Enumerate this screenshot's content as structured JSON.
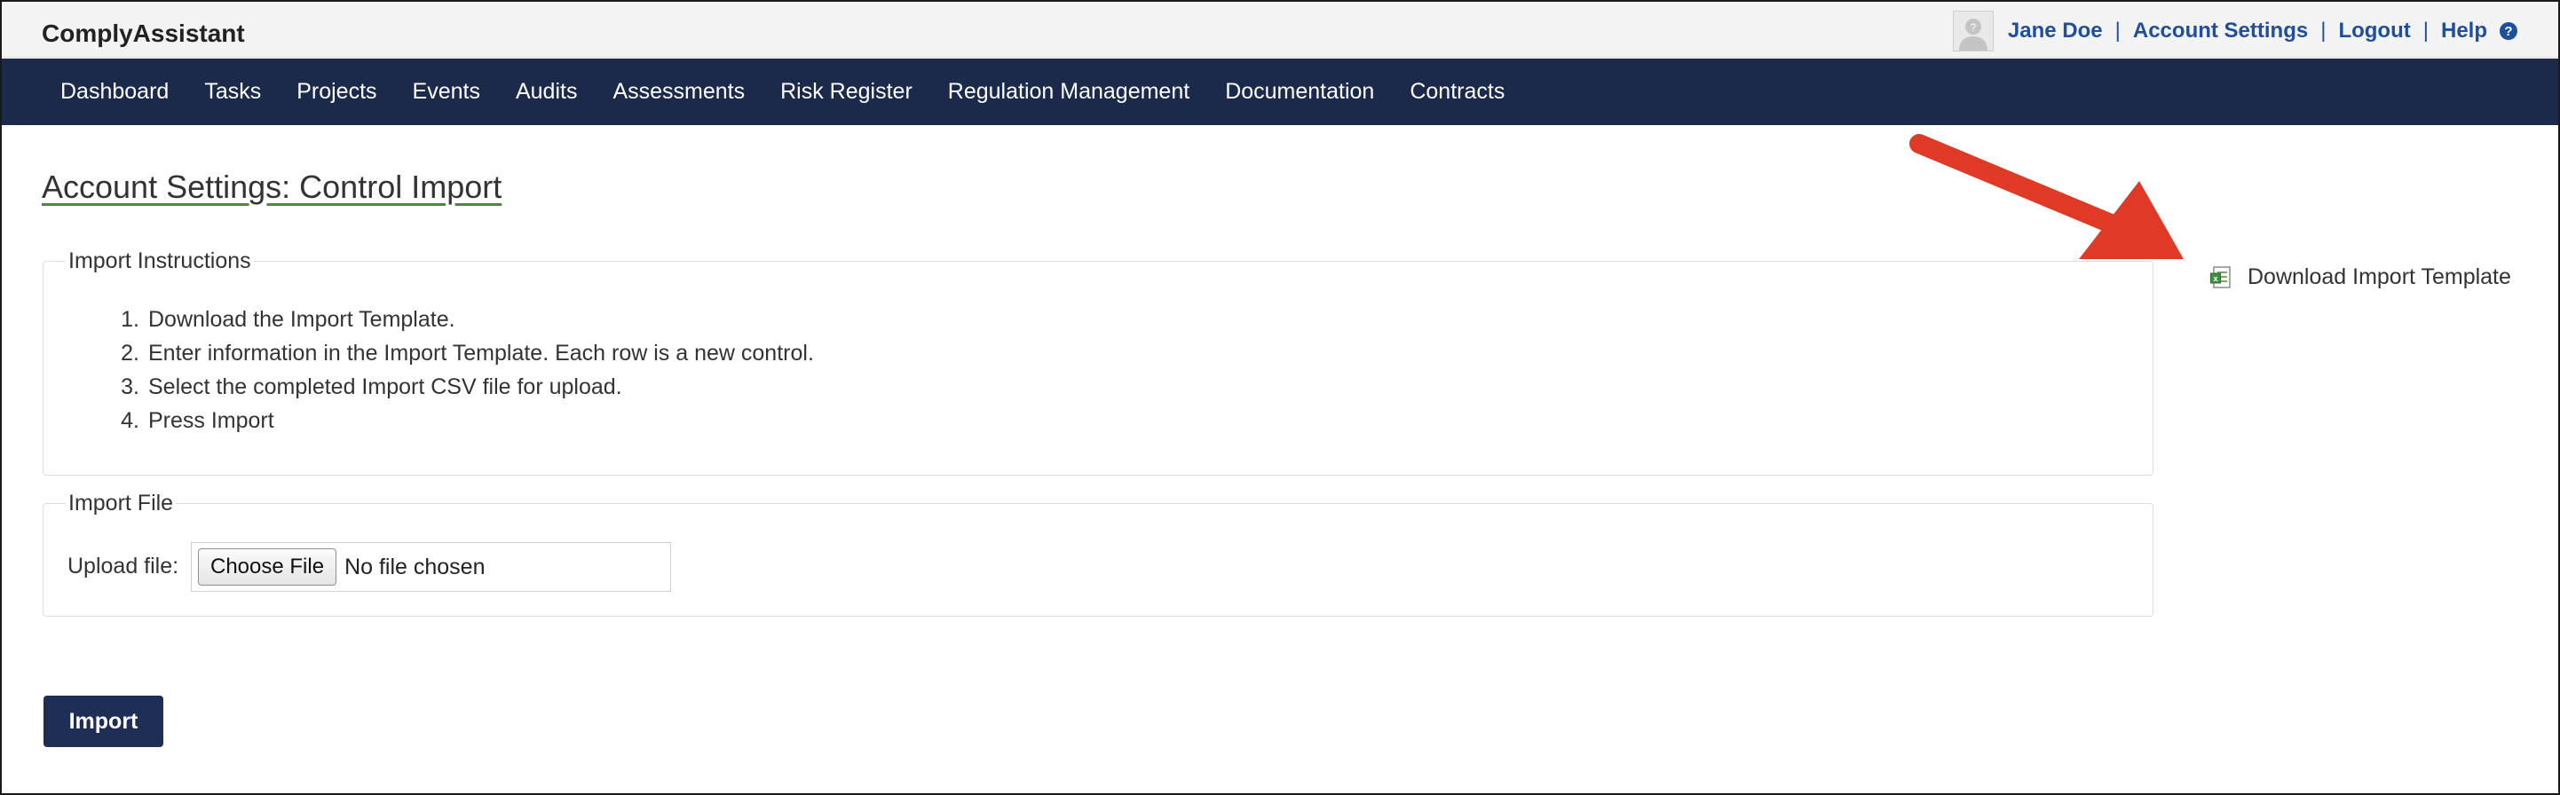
{
  "app": {
    "brand": "ComplyAssistant"
  },
  "user_menu": {
    "user_name": "Jane Doe",
    "account_settings": "Account Settings",
    "logout": "Logout",
    "help": "Help",
    "separator": "|",
    "help_icon_glyph": "?"
  },
  "nav": {
    "items": [
      "Dashboard",
      "Tasks",
      "Projects",
      "Events",
      "Audits",
      "Assessments",
      "Risk Register",
      "Regulation Management",
      "Documentation",
      "Contracts"
    ]
  },
  "page": {
    "title": "Account Settings: Control Import"
  },
  "instructions": {
    "legend": "Import Instructions",
    "steps": [
      {
        "num": "1.",
        "text": "Download the Import Template."
      },
      {
        "num": "2.",
        "text": "Enter information in the Import Template. Each row is a new control."
      },
      {
        "num": "3.",
        "text": "Select the completed Import CSV file for upload."
      },
      {
        "num": "4.",
        "text": "Press Import"
      }
    ]
  },
  "import_file": {
    "legend": "Import File",
    "upload_label": "Upload file:",
    "choose_button": "Choose File",
    "no_file_text": "No file chosen"
  },
  "actions": {
    "import_button": "Import"
  },
  "download": {
    "label": "Download Import Template",
    "icon": "spreadsheet-icon"
  },
  "annotation": {
    "arrow_color": "#e03a26"
  },
  "colors": {
    "nav_bg": "#1b2a4a",
    "link": "#1f4e9c",
    "button_bg": "#1f2e55"
  }
}
